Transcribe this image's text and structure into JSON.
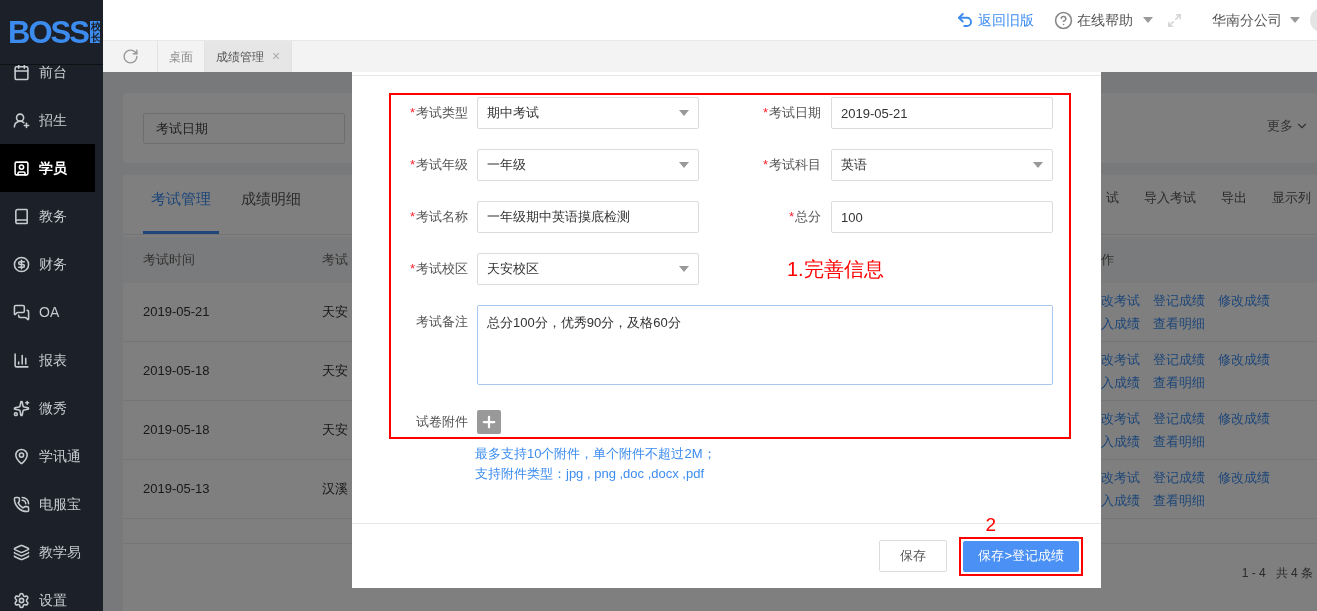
{
  "sidebar": {
    "logo": {
      "text": "BOSS",
      "badge": "校长"
    },
    "items": [
      {
        "label": "前台",
        "selected": false
      },
      {
        "label": "招生",
        "selected": false
      },
      {
        "label": "学员",
        "selected": true
      },
      {
        "label": "教务",
        "selected": false
      },
      {
        "label": "财务",
        "selected": false
      },
      {
        "label": "OA",
        "selected": false
      },
      {
        "label": "报表",
        "selected": false
      },
      {
        "label": "微秀",
        "selected": false
      },
      {
        "label": "学讯通",
        "selected": false
      },
      {
        "label": "电服宝",
        "selected": false
      },
      {
        "label": "教学易",
        "selected": false
      },
      {
        "label": "设置",
        "selected": false
      }
    ]
  },
  "header": {
    "back_link": "返回旧版",
    "help": "在线帮助",
    "company": "华南分公司"
  },
  "page_tabs": [
    {
      "label": "桌面",
      "selected": false
    },
    {
      "label": "成绩管理",
      "selected": true,
      "close": "×"
    }
  ],
  "filter": {
    "date_field": {
      "placeholder": "考试日期"
    },
    "more": "更多"
  },
  "list": {
    "tabs": [
      {
        "label": "考试管理",
        "selected": true
      },
      {
        "label": "成绩明细",
        "selected": false
      }
    ],
    "toolbar": [
      "试",
      "导入考试",
      "导出",
      "显示列"
    ],
    "columns": [
      "考试时间",
      "考试",
      "作"
    ],
    "rows": [
      {
        "date": "2019-05-21",
        "campus": "天安",
        "actions": [
          "改考试",
          "登记成绩",
          "修改成绩",
          "入成绩",
          "查看明细"
        ]
      },
      {
        "date": "2019-05-18",
        "campus": "天安",
        "actions": [
          "改考试",
          "登记成绩",
          "修改成绩",
          "入成绩",
          "查看明细"
        ]
      },
      {
        "date": "2019-05-18",
        "campus": "天安",
        "actions": [
          "改考试",
          "登记成绩",
          "修改成绩",
          "入成绩",
          "查看明细"
        ]
      },
      {
        "date": "2019-05-13",
        "campus": "汉溪",
        "actions": [
          "改考试",
          "登记成绩",
          "修改成绩",
          "入成绩",
          "查看明细"
        ]
      }
    ],
    "pagination": "1 - 4   共 4 条"
  },
  "dialog": {
    "required_mark": "*",
    "fields": [
      {
        "label": "考试类型",
        "required": true,
        "kind": "select",
        "value": "期中考试"
      },
      {
        "label": "考试日期",
        "required": true,
        "kind": "text",
        "value": "2019-05-21"
      },
      {
        "label": "考试年级",
        "required": true,
        "kind": "select",
        "value": "一年级"
      },
      {
        "label": "考试科目",
        "required": true,
        "kind": "select",
        "value": "英语"
      },
      {
        "label": "考试名称",
        "required": true,
        "kind": "text",
        "value": "一年级期中英语摸底检测"
      },
      {
        "label": "总分",
        "required": true,
        "kind": "text",
        "value": "100"
      },
      {
        "label": "考试校区",
        "required": true,
        "kind": "select",
        "value": "天安校区"
      }
    ],
    "remark": {
      "label": "考试备注",
      "value": "总分100分，优秀90分，及格60分"
    },
    "attachment": {
      "label": "试卷附件",
      "hints": [
        "最多支持10个附件，单个附件不超过2M；",
        "支持附件类型：jpg , png ,doc ,docx ,pdf"
      ]
    },
    "buttons": [
      {
        "label": "保存",
        "primary": false
      },
      {
        "label": "保存>登记成绩",
        "primary": true
      }
    ]
  },
  "annotations": [
    {
      "text": "1.完善信息"
    },
    {
      "text": "2"
    }
  ]
}
